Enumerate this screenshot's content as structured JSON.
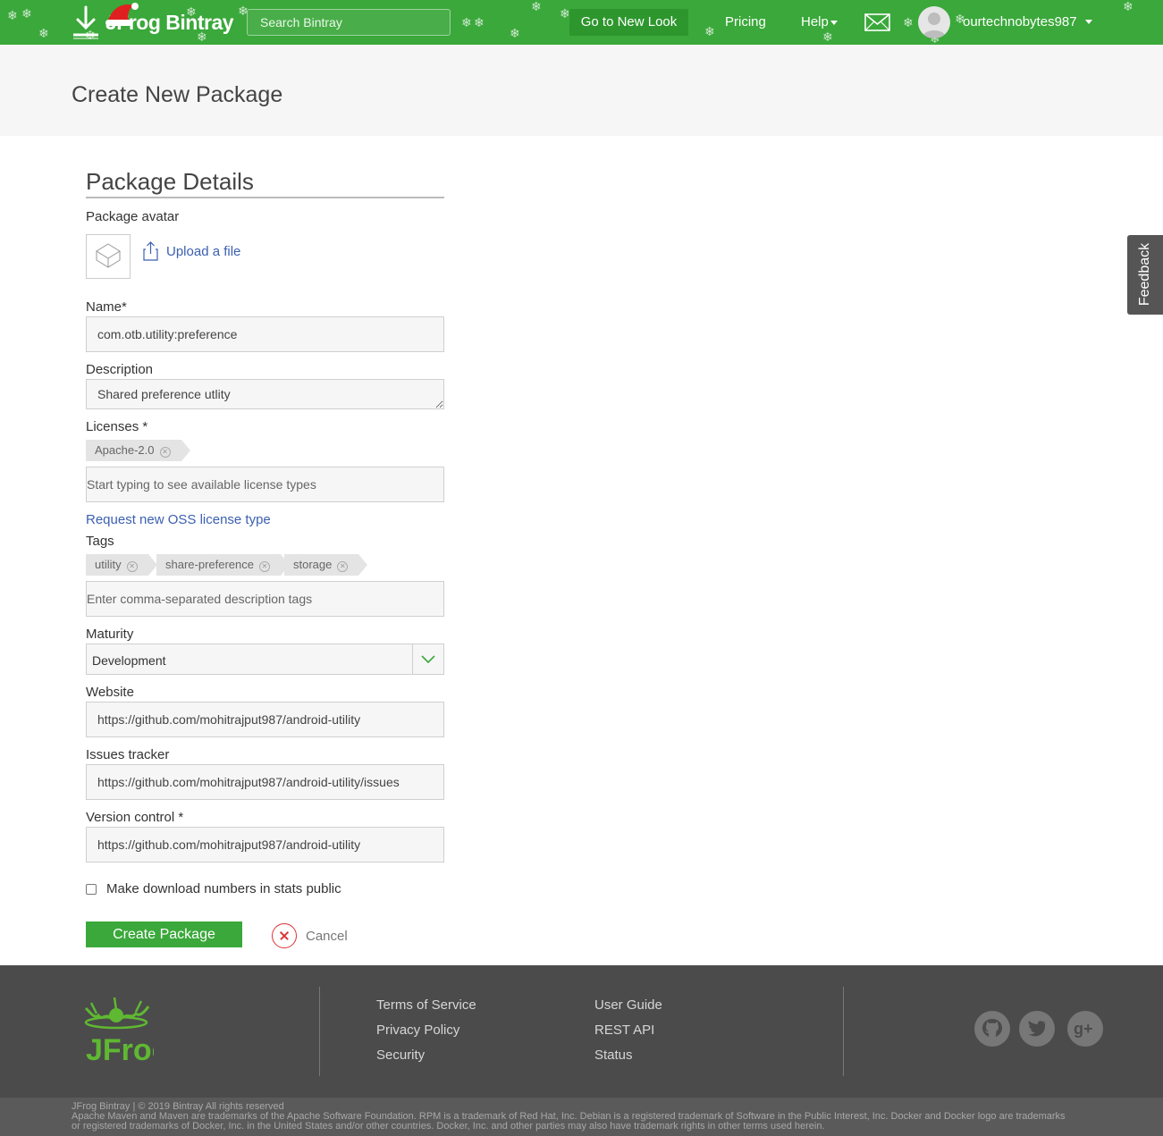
{
  "topbar": {
    "brand": "JFrog Bintray",
    "search_placeholder": "Search Bintray",
    "new_look_label": "Go to New Look",
    "pricing_label": "Pricing",
    "help_label": "Help",
    "username": "ourtechnobytes987"
  },
  "page": {
    "title": "Create New Package"
  },
  "form": {
    "section_title": "Package Details",
    "avatar_label": "Package avatar",
    "upload_label": "Upload a file",
    "name_label": "Name*",
    "name_value": "com.otb.utility:preference",
    "description_label": "Description",
    "description_value": "Shared preference utlity",
    "licenses_label": "Licenses *",
    "licenses": [
      "Apache-2.0"
    ],
    "license_placeholder": "Start typing to see available license types",
    "request_license_link": "Request new OSS license type",
    "tags_label": "Tags",
    "tags": [
      "utility",
      "share-preference",
      "storage"
    ],
    "tags_placeholder": "Enter comma-separated description tags",
    "maturity_label": "Maturity",
    "maturity_value": "Development",
    "website_label": "Website",
    "website_value": "https://github.com/mohitrajput987/android-utility",
    "issues_label": "Issues tracker",
    "issues_value": "https://github.com/mohitrajput987/android-utility/issues",
    "vcs_label": "Version control *",
    "vcs_value": "https://github.com/mohitrajput987/android-utility",
    "stats_checkbox_label": "Make download numbers in stats public",
    "stats_public": false,
    "create_label": "Create Package",
    "cancel_label": "Cancel"
  },
  "feedback_label": "Feedback",
  "footer": {
    "logo_text": "JFrog",
    "col1": [
      "Terms of Service",
      "Privacy Policy",
      "Security"
    ],
    "col2": [
      "User Guide",
      "REST API",
      "Status"
    ],
    "social_icons": [
      "github-icon",
      "twitter-icon",
      "google-plus-icon"
    ],
    "copyright": "JFrog Bintray | © 2019 Bintray All rights reserved",
    "trademarks": "Apache Maven and Maven are trademarks of the Apache Software Foundation. RPM is a trademark of Red Hat, Inc. Debian is a registered trademark of Software in the Public Interest, Inc. Docker and Docker logo are trademarks or registered trademarks of Docker, Inc. in the United States and/or other countries. Docker, Inc. and other parties may also have trademark rights in other terms used herein."
  },
  "colors": {
    "brand_green": "#3aa83a",
    "link_blue": "#3b5fb0",
    "footer_bg": "#4b4b4b",
    "cancel_red": "#dd3333"
  }
}
